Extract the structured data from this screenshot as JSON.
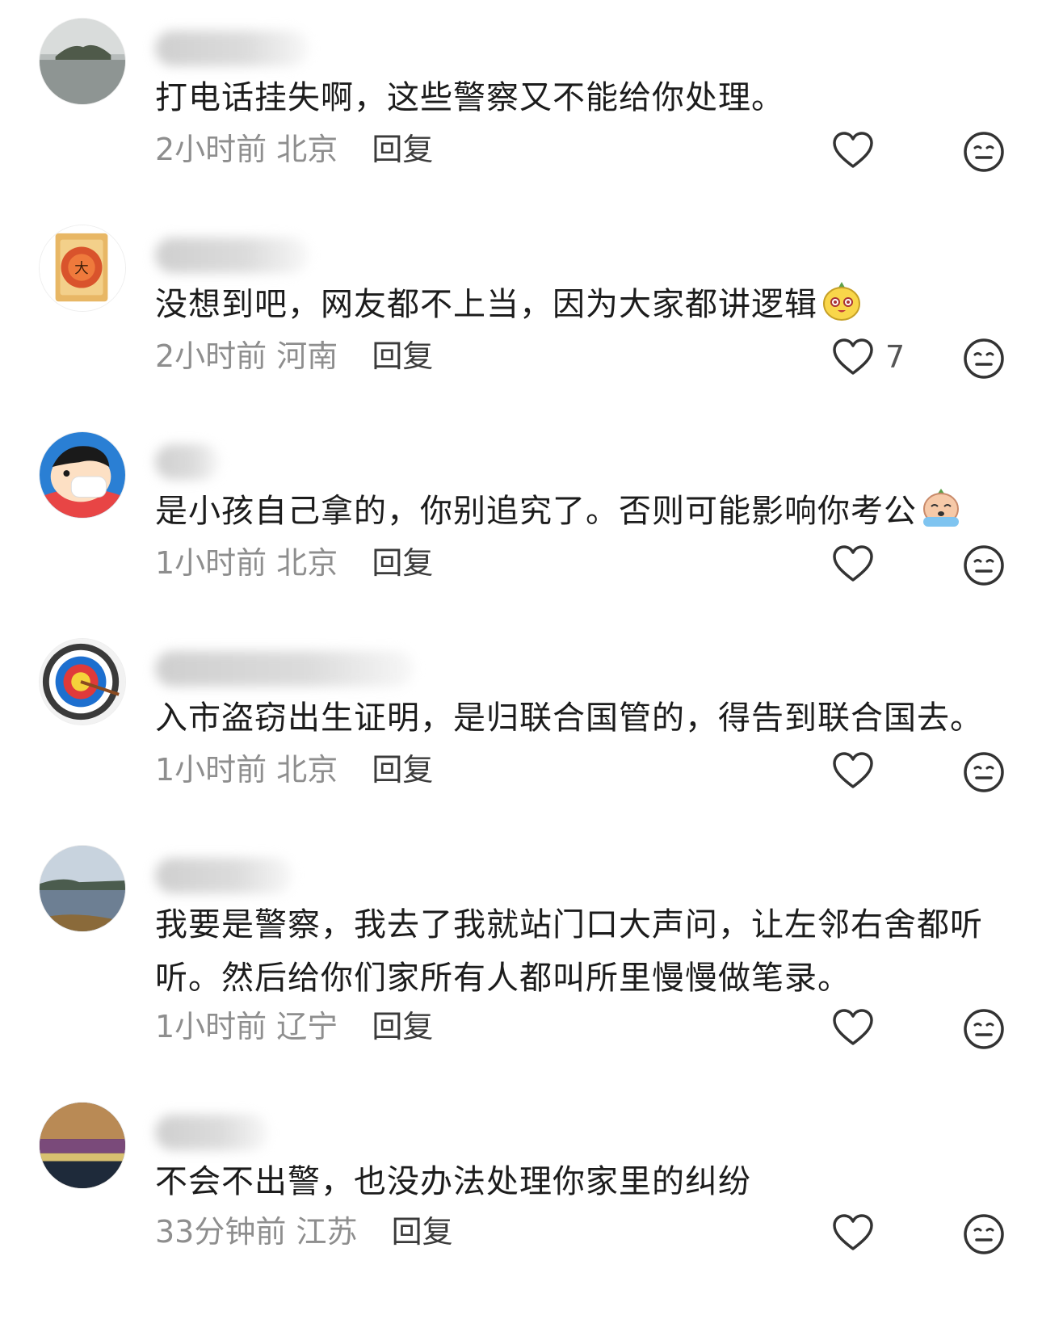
{
  "comments": [
    {
      "avatar_icon": "island-avatar-icon",
      "text": "打电话挂失啊，这些警察又不能给你处理。",
      "emoji": "",
      "time": "2小时前",
      "location": "北京",
      "reply": "回复",
      "likes": ""
    },
    {
      "avatar_icon": "mooncake-avatar-icon",
      "text": "没想到吧，网友都不上当，因为大家都讲逻辑",
      "emoji": "smug-face-emoji",
      "time": "2小时前",
      "location": "河南",
      "reply": "回复",
      "likes": "7"
    },
    {
      "avatar_icon": "cartoon-boy-avatar-icon",
      "text": "是小孩自己拿的，你别追究了。否则可能影响你考公",
      "emoji": "crying-face-emoji",
      "time": "1小时前",
      "location": "北京",
      "reply": "回复",
      "likes": ""
    },
    {
      "avatar_icon": "archery-target-avatar-icon",
      "text": "入市盗窃出生证明，是归联合国管的，得告到联合国去。",
      "emoji": "",
      "time": "1小时前",
      "location": "北京",
      "reply": "回复",
      "likes": ""
    },
    {
      "avatar_icon": "lake-avatar-icon",
      "text": "我要是警察，我去了我就站门口大声问，让左邻右舍都听听。然后给你们家所有人都叫所里慢慢做笔录。",
      "emoji": "",
      "time": "1小时前",
      "location": "辽宁",
      "reply": "回复",
      "likes": ""
    },
    {
      "avatar_icon": "night-city-avatar-icon",
      "text": "不会不出警，也没办法处理你家里的纠纷",
      "emoji": "",
      "time": "33分钟前",
      "location": "江苏",
      "reply": "回复",
      "likes": ""
    }
  ],
  "icons": {
    "like": "heart-outline-icon",
    "dislike": "neutral-face-icon"
  },
  "colors": {
    "text": "#1c1c1c",
    "meta": "#8e8e8e",
    "icon": "#333333"
  }
}
